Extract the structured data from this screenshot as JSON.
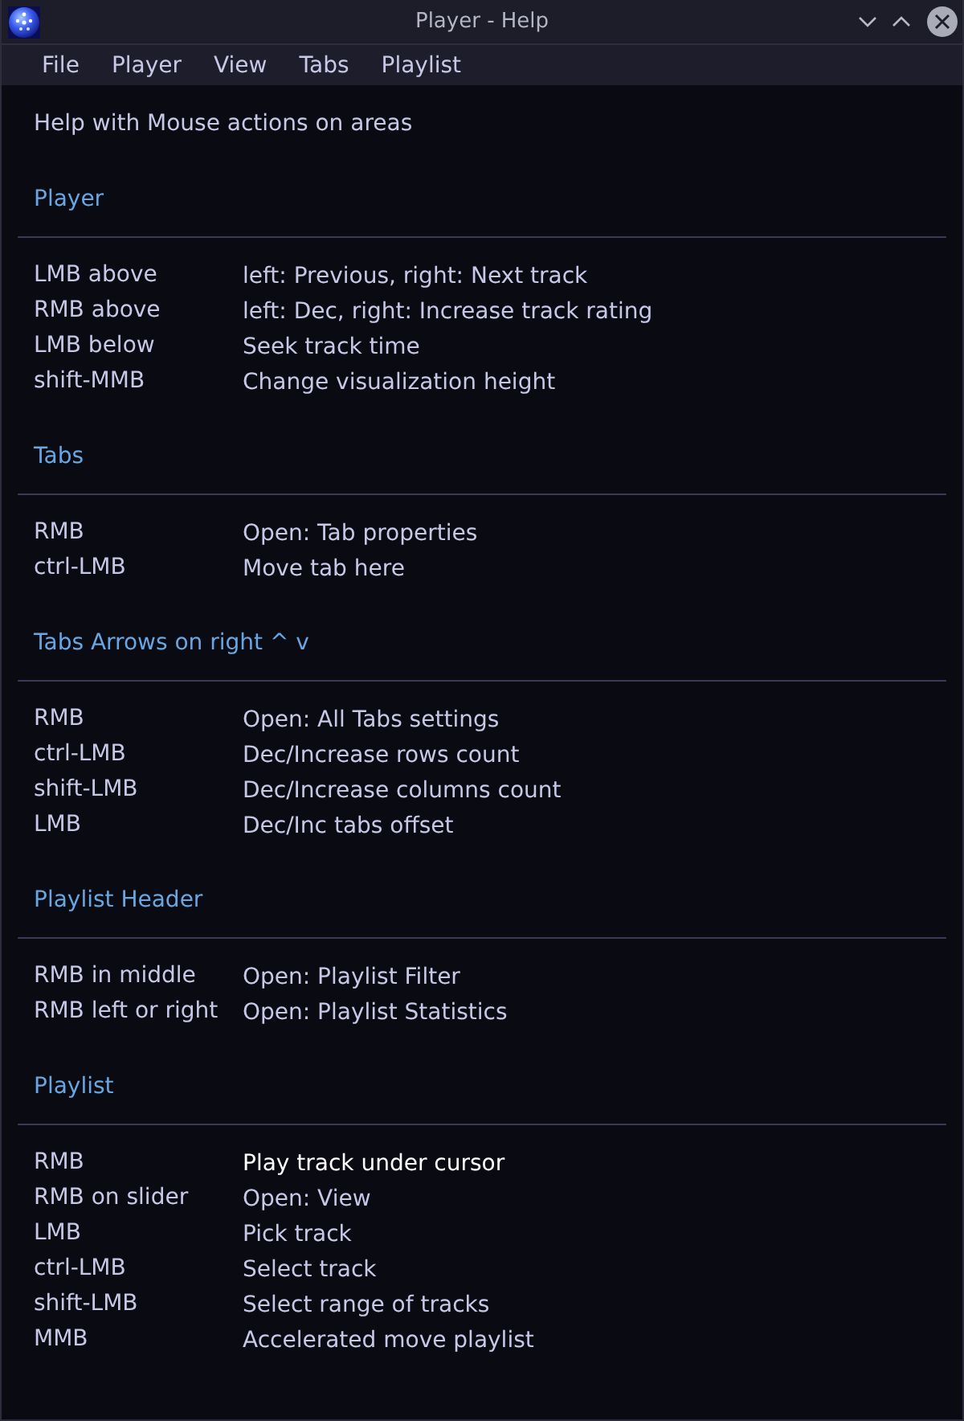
{
  "window": {
    "title": "Player - Help"
  },
  "menu": [
    "File",
    "Player",
    "View",
    "Tabs",
    "Playlist"
  ],
  "intro": "Help with Mouse actions on areas",
  "sections": [
    {
      "heading": "Player",
      "rows": [
        {
          "input": "LMB above",
          "action": "left: Previous, right: Next track",
          "highlighted": false
        },
        {
          "input": "RMB above",
          "action": "left: Dec, right: Increase track rating",
          "highlighted": false
        },
        {
          "input": "LMB below",
          "action": "Seek track time",
          "highlighted": false
        },
        {
          "input": "shift-MMB",
          "action": "Change visualization height",
          "highlighted": false
        }
      ]
    },
    {
      "heading": "Tabs",
      "rows": [
        {
          "input": "RMB",
          "action": "Open: Tab properties",
          "highlighted": false
        },
        {
          "input": "ctrl-LMB",
          "action": "Move tab here",
          "highlighted": false
        }
      ]
    },
    {
      "heading": "Tabs Arrows on right ^ v",
      "rows": [
        {
          "input": "RMB",
          "action": "Open: All Tabs settings",
          "highlighted": false
        },
        {
          "input": "ctrl-LMB",
          "action": "Dec/Increase rows count",
          "highlighted": false
        },
        {
          "input": "shift-LMB",
          "action": "Dec/Increase columns count",
          "highlighted": false
        },
        {
          "input": "LMB",
          "action": "Dec/Inc tabs offset",
          "highlighted": false
        }
      ]
    },
    {
      "heading": "Playlist Header",
      "rows": [
        {
          "input": "RMB in middle",
          "action": "Open: Playlist Filter",
          "highlighted": false
        },
        {
          "input": "RMB left or right",
          "action": "Open: Playlist Statistics",
          "highlighted": false
        }
      ]
    },
    {
      "heading": "Playlist",
      "rows": [
        {
          "input": "RMB",
          "action": "Play track under cursor",
          "highlighted": true
        },
        {
          "input": "RMB on slider",
          "action": "Open: View",
          "highlighted": false
        },
        {
          "input": "LMB",
          "action": "Pick track",
          "highlighted": false
        },
        {
          "input": "ctrl-LMB",
          "action": "Select track",
          "highlighted": false
        },
        {
          "input": "shift-LMB",
          "action": "Select range of tracks",
          "highlighted": false
        },
        {
          "input": "MMB",
          "action": "Accelerated move playlist",
          "highlighted": false
        }
      ]
    }
  ]
}
